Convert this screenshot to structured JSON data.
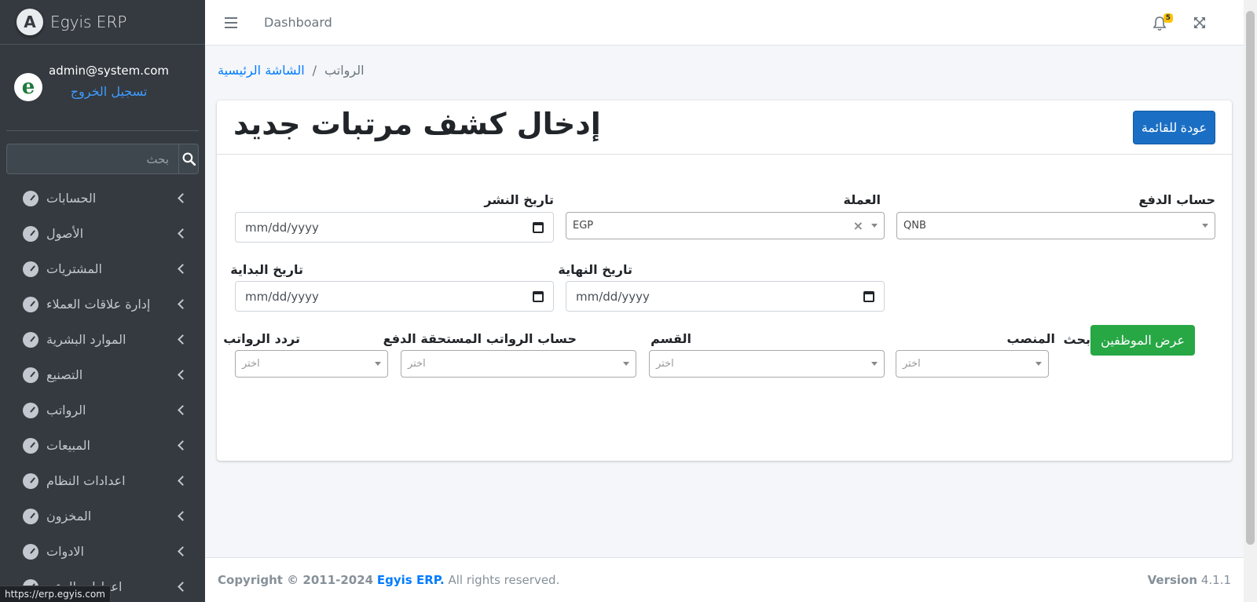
{
  "sidebar": {
    "brand": "Egyis ERP",
    "brand_logo_letter": "A",
    "user_avatar_letter": "e",
    "user_email": "admin@system.com",
    "logout": "تسجيل الخروج",
    "search_placeholder": "بحث",
    "items": [
      {
        "label": "الحسابات"
      },
      {
        "label": "الأصول"
      },
      {
        "label": "المشتريات"
      },
      {
        "label": "إدارة علاقات العملاء"
      },
      {
        "label": "الموارد البشرية"
      },
      {
        "label": "التصنيع"
      },
      {
        "label": "الرواتب"
      },
      {
        "label": "المبيعات"
      },
      {
        "label": "اعدادات النظام"
      },
      {
        "label": "المخزون"
      },
      {
        "label": "الادوات"
      },
      {
        "label": "اعدادات الدعم"
      }
    ]
  },
  "status_url": "https://erp.egyis.com",
  "navbar": {
    "dashboard": "Dashboard",
    "notification_count": "5"
  },
  "breadcrumb": {
    "home": "الشاشة الرئيسية",
    "separator": "/",
    "current": "الرواتب"
  },
  "card": {
    "title": "إدخال كشف مرتبات جديد",
    "back_button": "عودة للقائمة"
  },
  "form": {
    "payment_account_label": "حساب الدفع",
    "payment_account_value": "QNB",
    "currency_label": "العملة",
    "currency_value": "EGP",
    "publish_date_label": "تاريخ النشر",
    "publish_date_placeholder": "mm/dd/yyyy",
    "end_date_label": "تاريخ النهاية",
    "end_date_placeholder": "mm/dd/yyyy",
    "start_date_label": "تاريخ البداية",
    "start_date_placeholder": "mm/dd/yyyy",
    "search_label": "بحث",
    "show_employees_button": "عرض الموظفين",
    "position_label": "المنصب",
    "position_placeholder": "اختر",
    "department_label": "القسم",
    "department_placeholder": "اختر",
    "payable_account_label": "حساب الرواتب المستحقة الدفع",
    "payable_account_placeholder": "اختر",
    "frequency_label": "تردد الرواتب",
    "frequency_placeholder": "اختر"
  },
  "footer": {
    "copyright": "Copyright © 2011-2024",
    "brand_link": "Egyis ERP.",
    "rights": "All rights reserved.",
    "version_label": "Version",
    "version_value": "4.1.1"
  }
}
